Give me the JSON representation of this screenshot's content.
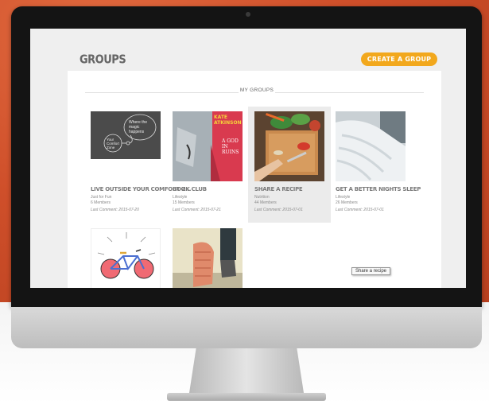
{
  "header": {
    "title": "GROUPS",
    "create_label": "CREATE A GROUP"
  },
  "section": {
    "title": "MY GROUPS"
  },
  "groups": [
    {
      "name": "LIVE OUTSIDE YOUR COMFORT Z...",
      "category": "Just for Fun",
      "members": "6 Members",
      "last_comment": "Last Comment: 2015-07-20",
      "image_text_1": "Where the magic happens",
      "image_text_2": "Your Comfort Zone"
    },
    {
      "name": "BOOK CLUB",
      "category": "Lifestyle",
      "members": "15 Members",
      "last_comment": "Last Comment: 2015-07-21",
      "book_title_1": "KATE ATKINSON",
      "book_title_2": "A GOD IN RUINS"
    },
    {
      "name": "SHARE A RECIPE",
      "category": "Nutrition",
      "members": "44 Members",
      "last_comment": "Last Comment: 2015-07-01"
    },
    {
      "name": "GET A BETTER NIGHTS SLEEP",
      "category": "Lifestyle",
      "members": "26 Members",
      "last_comment": "Last Comment: 2015-07-01"
    },
    {
      "name": "",
      "category": "",
      "members": "",
      "last_comment": ""
    },
    {
      "name": "",
      "category": "",
      "members": "",
      "last_comment": ""
    }
  ],
  "tooltip": "Share a recipe",
  "colors": {
    "accent": "#f2a81d",
    "background": "#cf4f2a"
  },
  "icons": [
    "camera-icon"
  ]
}
